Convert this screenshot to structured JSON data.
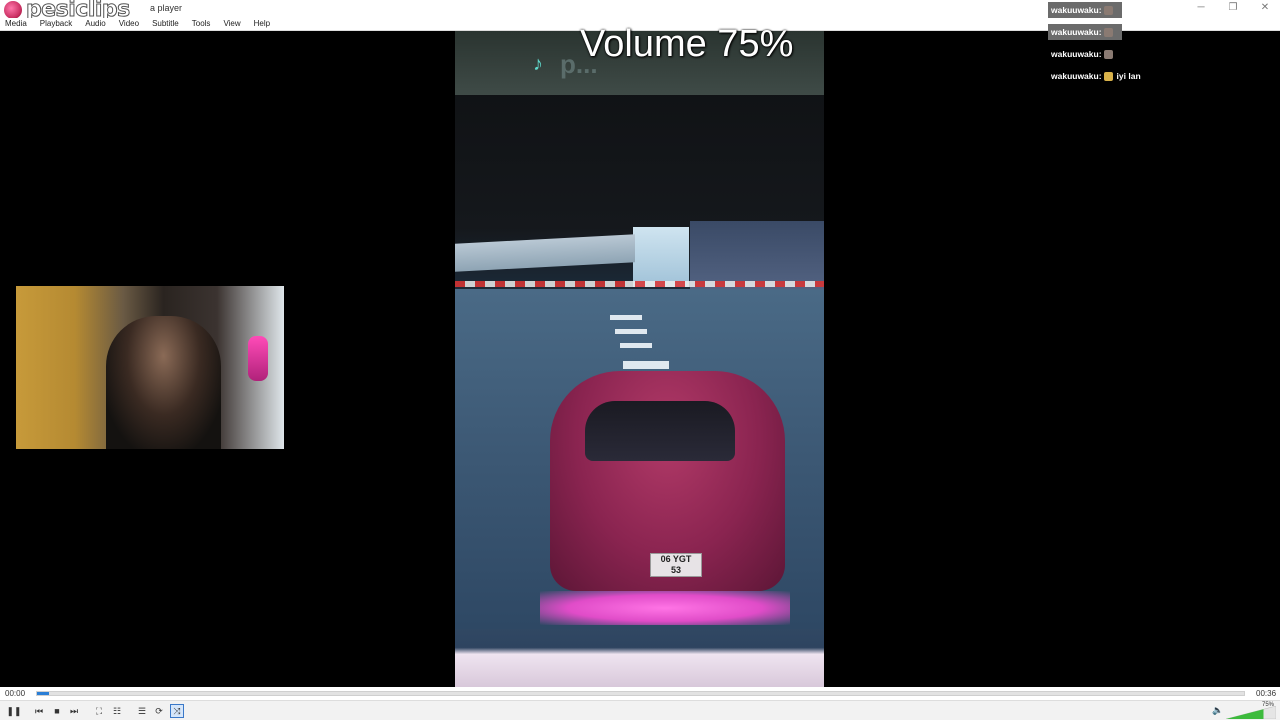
{
  "titlebar": {
    "logo_text": "pesiclips",
    "window_title": "a player",
    "buttons": [
      "─",
      "❐",
      "✕"
    ]
  },
  "menu": [
    "Media",
    "Playback",
    "Audio",
    "Video",
    "Subtitle",
    "Tools",
    "View",
    "Help"
  ],
  "video": {
    "overlay_user": "p...",
    "osd": "Volume 75%",
    "plate": [
      "06 YGT",
      "53"
    ]
  },
  "chat": [
    {
      "user": "wakuuwaku:",
      "message": "",
      "highlight": true
    },
    {
      "user": "wakuuwaku:",
      "message": "",
      "highlight": true
    },
    {
      "user": "wakuuwaku:",
      "message": "",
      "highlight": false
    },
    {
      "user": "wakuuwaku:",
      "message": "iyi lan",
      "highlight": false
    }
  ],
  "seek": {
    "current_time": "00:00",
    "total_time": "00:36",
    "progress_fraction": 0.01
  },
  "controls": {
    "buttons": [
      {
        "name": "pause-button",
        "icon": "pause-icon",
        "glyph": "❚❚"
      },
      {
        "name": "previous-button",
        "icon": "skip-back-icon",
        "glyph": "⏮"
      },
      {
        "name": "stop-button",
        "icon": "stop-icon",
        "glyph": "■"
      },
      {
        "name": "next-button",
        "icon": "skip-forward-icon",
        "glyph": "⏭"
      },
      {
        "name": "fullscreen-button",
        "icon": "fullscreen-icon",
        "glyph": "⛶"
      },
      {
        "name": "extended-settings-button",
        "icon": "equalizer-icon",
        "glyph": "☷"
      },
      {
        "name": "playlist-button",
        "icon": "playlist-icon",
        "glyph": "☰"
      },
      {
        "name": "loop-button",
        "icon": "loop-icon",
        "glyph": "⟳"
      },
      {
        "name": "shuffle-button",
        "icon": "shuffle-icon",
        "glyph": "⤨",
        "active": true
      }
    ],
    "volume_label": "75%",
    "volume_fraction": 0.75
  },
  "colors": {
    "accent": "#2a7ed6",
    "chat_highlight": "#6b6b6b",
    "underglow": "#ff74e5"
  }
}
